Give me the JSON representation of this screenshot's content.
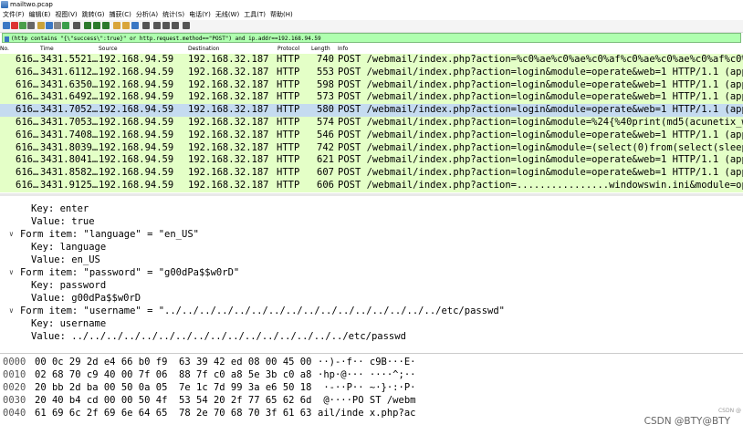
{
  "window": {
    "title": "mailtwo.pcap"
  },
  "menu": [
    "文件(F)",
    "编辑(E)",
    "视图(V)",
    "跳转(G)",
    "捕获(C)",
    "分析(A)",
    "统计(S)",
    "电话(Y)",
    "无线(W)",
    "工具(T)",
    "帮助(H)"
  ],
  "toolbar": {
    "icons": [
      "shark-fin-icon",
      "stop-icon",
      "restart-icon",
      "gear-icon",
      "open-folder-icon",
      "save-icon",
      "close-file-icon",
      "reload-icon",
      "find-icon",
      "back-icon",
      "forward-icon",
      "jump-icon",
      "first-icon",
      "last-icon",
      "autoscroll-icon",
      "colorize-icon",
      "zoom-in-icon",
      "zoom-out-icon",
      "zoom-reset-icon",
      "resize-columns-icon"
    ]
  },
  "filter": {
    "text": "(http contains \"{\\\"success\\\":true}\" or http.request.method==\"POST\") and ip.addr==192.168.94.59"
  },
  "columns": [
    "No.",
    "Time",
    "Source",
    "Destination",
    "Protocol",
    "Length",
    "Info"
  ],
  "packets": [
    {
      "no": "616…",
      "time": "3431.5521…",
      "src": "192.168.94.59",
      "dst": "192.168.32.187",
      "proto": "HTTP",
      "len": "740",
      "info": "POST /webmail/index.php?action=%c0%ae%c0%ae%c0%af%c0%ae%c0%ae%c0%af%c0%ae%"
    },
    {
      "no": "616…",
      "time": "3431.6112…",
      "src": "192.168.94.59",
      "dst": "192.168.32.187",
      "proto": "HTTP",
      "len": "553",
      "info": "POST /webmail/index.php?action=login&module=operate&web=1 HTTP/1.1  (appli"
    },
    {
      "no": "616…",
      "time": "3431.6350…",
      "src": "192.168.94.59",
      "dst": "192.168.32.187",
      "proto": "HTTP",
      "len": "598",
      "info": "POST /webmail/index.php?action=login&module=operate&web=1 HTTP/1.1  (appli"
    },
    {
      "no": "616…",
      "time": "3431.6492…",
      "src": "192.168.94.59",
      "dst": "192.168.32.187",
      "proto": "HTTP",
      "len": "573",
      "info": "POST /webmail/index.php?action=login&module=operate&web=1 HTTP/1.1  (appli"
    },
    {
      "no": "616…",
      "time": "3431.7052…",
      "src": "192.168.94.59",
      "dst": "192.168.32.187",
      "proto": "HTTP",
      "len": "580",
      "info": "POST /webmail/index.php?action=login&module=operate&web=1 HTTP/1.1  (appli",
      "selected": true
    },
    {
      "no": "616…",
      "time": "3431.7053…",
      "src": "192.168.94.59",
      "dst": "192.168.32.187",
      "proto": "HTTP",
      "len": "574",
      "info": "POST /webmail/index.php?action=login&module=%24{%40print(md5(acunetix_wvs_"
    },
    {
      "no": "616…",
      "time": "3431.7408…",
      "src": "192.168.94.59",
      "dst": "192.168.32.187",
      "proto": "HTTP",
      "len": "546",
      "info": "POST /webmail/index.php?action=login&module=operate&web=1 HTTP/1.1  (appli"
    },
    {
      "no": "616…",
      "time": "3431.8039…",
      "src": "192.168.94.59",
      "dst": "192.168.32.187",
      "proto": "HTTP",
      "len": "742",
      "info": "POST /webmail/index.php?action=login&module=(select(0)from(select(sleep(9)"
    },
    {
      "no": "616…",
      "time": "3431.8041…",
      "src": "192.168.94.59",
      "dst": "192.168.32.187",
      "proto": "HTTP",
      "len": "621",
      "info": "POST /webmail/index.php?action=login&module=operate&web=1 HTTP/1.1  (appli"
    },
    {
      "no": "616…",
      "time": "3431.8582…",
      "src": "192.168.94.59",
      "dst": "192.168.32.187",
      "proto": "HTTP",
      "len": "607",
      "info": "POST /webmail/index.php?action=login&module=operate&web=1 HTTP/1.1  (appli"
    },
    {
      "no": "616…",
      "time": "3431.9125…",
      "src": "192.168.94.59",
      "dst": "192.168.32.187",
      "proto": "HTTP",
      "len": "606",
      "info": "POST /webmail/index.php?action=................windowswin.ini&module=opera"
    }
  ],
  "details": [
    {
      "text": "Key: enter",
      "indent": 2,
      "arrow": ""
    },
    {
      "text": "Value: true",
      "indent": 2,
      "arrow": ""
    },
    {
      "text": "Form item: \"language\" = \"en_US\"",
      "indent": 1,
      "arrow": "expanded"
    },
    {
      "text": "Key: language",
      "indent": 2,
      "arrow": ""
    },
    {
      "text": "Value: en_US",
      "indent": 2,
      "arrow": ""
    },
    {
      "text": "Form item: \"password\" = \"g00dPa$$w0rD\"",
      "indent": 1,
      "arrow": "expanded"
    },
    {
      "text": "Key: password",
      "indent": 2,
      "arrow": ""
    },
    {
      "text": "Value: g00dPa$$w0rD",
      "indent": 2,
      "arrow": ""
    },
    {
      "text": "Form item: \"username\" = \"../../../../../../../../../../../../../../../../etc/passwd\"",
      "indent": 1,
      "arrow": "expanded"
    },
    {
      "text": "Key: username",
      "indent": 2,
      "arrow": ""
    },
    {
      "text": "Value: ../../../../../../../../../../../../../../../../etc/passwd",
      "indent": 2,
      "arrow": ""
    }
  ],
  "hex": [
    {
      "off": "0000",
      "bytes": "00 0c 29 2d e4 66 b0 f9  63 39 42 ed 08 00 45 00",
      "ascii": "··)-·f·· c9B···E·"
    },
    {
      "off": "0010",
      "bytes": "02 68 70 c9 40 00 7f 06  88 7f c0 a8 5e 3b c0 a8",
      "ascii": "·hp·@··· ····^;··"
    },
    {
      "off": "0020",
      "bytes": "20 bb 2d ba 00 50 0a 05  7e 1c 7d 99 3a e6 50 18",
      "ascii": " ·-··P·· ~·}·:·P·"
    },
    {
      "off": "0030",
      "bytes": "20 40 b4 cd 00 00 50 4f  53 54 20 2f 77 65 62 6d",
      "ascii": " @····PO ST /webm"
    },
    {
      "off": "0040",
      "bytes": "61 69 6c 2f 69 6e 64 65  78 2e 70 68 70 3f 61 63",
      "ascii": "ail/inde x.php?ac"
    }
  ],
  "watermark": "CSDN @BTY@BTY",
  "watermark_small": "CSDN @"
}
